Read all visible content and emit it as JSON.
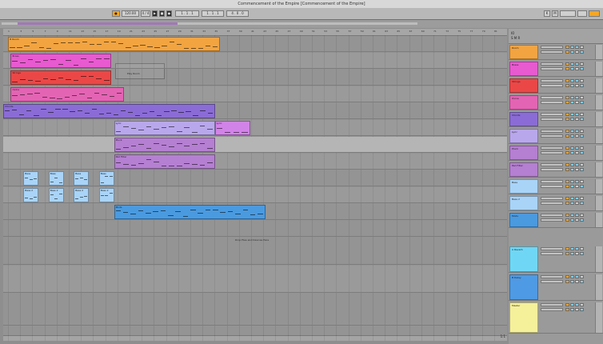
{
  "window": {
    "title": "Commencement of the Empire  [Commencement of the Empire]"
  },
  "transport": {
    "tempo": "120.00",
    "signature": "4 / 4",
    "position": "1 . 1 . 1",
    "loop_start": "1 . 1 . 1",
    "loop_length": "4 . 0 . 0"
  },
  "ruler": [
    "1",
    "3",
    "5",
    "7",
    "9",
    "11",
    "13",
    "15",
    "17",
    "19",
    "21",
    "23",
    "25",
    "27",
    "29",
    "31",
    "33",
    "35",
    "37",
    "39",
    "41",
    "43",
    "45",
    "47",
    "49",
    "51",
    "53",
    "55",
    "57",
    "59",
    "61",
    "63",
    "65",
    "67",
    "69",
    "71",
    "73",
    "75",
    "77",
    "79",
    "81"
  ],
  "clips": [
    {
      "name": "B Room",
      "lane": 0,
      "start": 0.01,
      "end": 0.43,
      "color": "#f2a440"
    },
    {
      "name": "Brass",
      "lane": 1,
      "start": 0.015,
      "end": 0.215,
      "color": "#e85ad0"
    },
    {
      "name": "Strings",
      "lane": 2,
      "start": 0.015,
      "end": 0.215,
      "color": "#ec4747"
    },
    {
      "name": "Ovine",
      "lane": 3,
      "start": 0.015,
      "end": 0.24,
      "color": "#e364b3"
    },
    {
      "name": "Chords",
      "lane": 4,
      "start": 0.0,
      "end": 0.42,
      "color": "#8b6cd6"
    },
    {
      "name": "Lyric",
      "lane": 5,
      "start": 0.22,
      "end": 0.42,
      "color": "#b9a7ec"
    },
    {
      "name": "Lyric",
      "lane": 5,
      "start": 0.42,
      "end": 0.49,
      "color": "#d283e8"
    },
    {
      "name": "Pluck",
      "lane": 6,
      "start": 0.22,
      "end": 0.42,
      "color": "#b57fd2"
    },
    {
      "name": "Pad Filter",
      "lane": 7,
      "start": 0.22,
      "end": 0.42,
      "color": "#b57fd2"
    },
    {
      "name": "Bass",
      "lane": 8,
      "start": 0.04,
      "end": 0.07,
      "color": "#a9d4f8"
    },
    {
      "name": "Bass",
      "lane": 8,
      "start": 0.09,
      "end": 0.12,
      "color": "#a9d4f8"
    },
    {
      "name": "Bass",
      "lane": 8,
      "start": 0.14,
      "end": 0.17,
      "color": "#a9d4f8"
    },
    {
      "name": "Bass",
      "lane": 8,
      "start": 0.19,
      "end": 0.22,
      "color": "#a9d4f8"
    },
    {
      "name": "Bass 2",
      "lane": 9,
      "start": 0.04,
      "end": 0.07,
      "color": "#a9d4f8"
    },
    {
      "name": "Bass 2",
      "lane": 9,
      "start": 0.09,
      "end": 0.12,
      "color": "#a9d4f8"
    },
    {
      "name": "Bass 2",
      "lane": 9,
      "start": 0.14,
      "end": 0.17,
      "color": "#a9d4f8"
    },
    {
      "name": "Bass 2",
      "lane": 9,
      "start": 0.19,
      "end": 0.22,
      "color": "#a9d4f8"
    },
    {
      "name": "Mods",
      "lane": 10,
      "start": 0.22,
      "end": 0.52,
      "color": "#4a9ae0"
    }
  ],
  "ghost": {
    "label": "Drop Files and Devices Here",
    "sublabel": "Play Room"
  },
  "tracks": [
    {
      "name": "Room",
      "color": "#f2a440"
    },
    {
      "name": "Brass",
      "color": "#e85ad0"
    },
    {
      "name": "Strings",
      "color": "#ec4747"
    },
    {
      "name": "Ovine",
      "color": "#e364b3"
    },
    {
      "name": "Chords",
      "color": "#8b6cd6"
    },
    {
      "name": "Lyric",
      "color": "#b9a7ec"
    },
    {
      "name": "Pluck",
      "color": "#b57fd2"
    },
    {
      "name": "Pad Filter",
      "color": "#b57fd2"
    },
    {
      "name": "Bass",
      "color": "#a9d4f8"
    },
    {
      "name": "Bass 2",
      "color": "#a9d4f8"
    },
    {
      "name": "Mods",
      "color": "#4a9ae0"
    }
  ],
  "returns": [
    {
      "name": "A Reverb",
      "color": "#6fd7f5"
    },
    {
      "name": "B Delay",
      "color": "#4f9ae4"
    },
    {
      "name": "Master",
      "color": "#f5f09a"
    }
  ],
  "mixer_head": {
    "label": "IO",
    "sub": "S M R"
  },
  "zoom": "1:1"
}
